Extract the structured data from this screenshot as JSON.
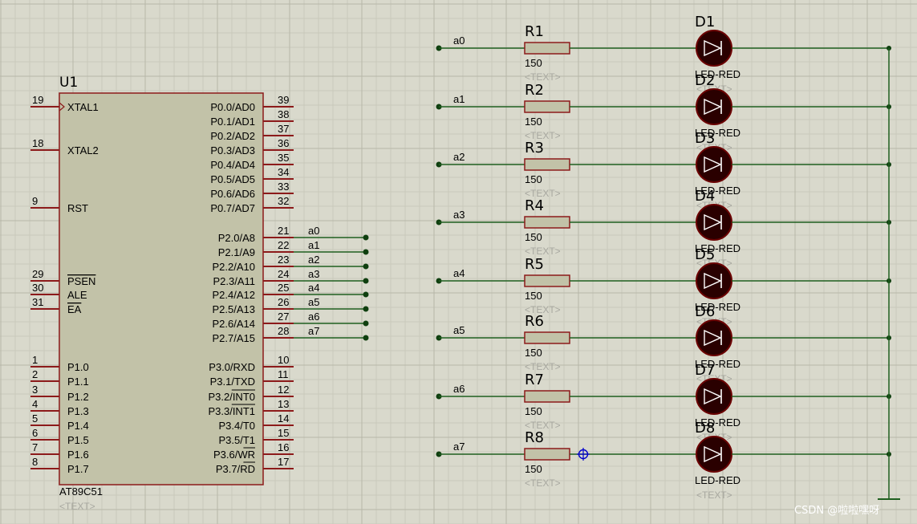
{
  "chip": {
    "ref": "U1",
    "part": "AT89C51",
    "text_placeholder": "<TEXT>",
    "left_pins": [
      {
        "num": "19",
        "label": "XTAL1",
        "clock": true
      },
      {
        "num": "18",
        "label": "XTAL2"
      },
      {
        "num": "9",
        "label": "RST"
      },
      {
        "num": "29",
        "label": "PSEN",
        "overline": true
      },
      {
        "num": "30",
        "label": "ALE"
      },
      {
        "num": "31",
        "label": "EA",
        "overline": true
      },
      {
        "num": "1",
        "label": "P1.0"
      },
      {
        "num": "2",
        "label": "P1.1"
      },
      {
        "num": "3",
        "label": "P1.2"
      },
      {
        "num": "4",
        "label": "P1.3"
      },
      {
        "num": "5",
        "label": "P1.4"
      },
      {
        "num": "6",
        "label": "P1.5"
      },
      {
        "num": "7",
        "label": "P1.6"
      },
      {
        "num": "8",
        "label": "P1.7"
      }
    ],
    "right_pins": [
      {
        "num": "39",
        "label": "P0.0/AD0"
      },
      {
        "num": "38",
        "label": "P0.1/AD1"
      },
      {
        "num": "37",
        "label": "P0.2/AD2"
      },
      {
        "num": "36",
        "label": "P0.3/AD3"
      },
      {
        "num": "35",
        "label": "P0.4/AD4"
      },
      {
        "num": "34",
        "label": "P0.5/AD5"
      },
      {
        "num": "33",
        "label": "P0.6/AD6"
      },
      {
        "num": "32",
        "label": "P0.7/AD7"
      },
      {
        "num": "21",
        "label": "P2.0/A8",
        "net": "a0"
      },
      {
        "num": "22",
        "label": "P2.1/A9",
        "net": "a1"
      },
      {
        "num": "23",
        "label": "P2.2/A10",
        "net": "a2"
      },
      {
        "num": "24",
        "label": "P2.3/A11",
        "net": "a3"
      },
      {
        "num": "25",
        "label": "P2.4/A12",
        "net": "a4"
      },
      {
        "num": "26",
        "label": "P2.5/A13",
        "net": "a5"
      },
      {
        "num": "27",
        "label": "P2.6/A14",
        "net": "a6"
      },
      {
        "num": "28",
        "label": "P2.7/A15",
        "net": "a7"
      },
      {
        "num": "10",
        "label": "P3.0/RXD"
      },
      {
        "num": "11",
        "label": "P3.1/TXD"
      },
      {
        "num": "12",
        "label": "P3.2/INT0",
        "overline_part": "INT0"
      },
      {
        "num": "13",
        "label": "P3.3/INT1",
        "overline_part": "INT1"
      },
      {
        "num": "14",
        "label": "P3.4/T0"
      },
      {
        "num": "15",
        "label": "P3.5/T1"
      },
      {
        "num": "16",
        "label": "P3.6/WR",
        "overline_part": "WR"
      },
      {
        "num": "17",
        "label": "P3.7/RD",
        "overline_part": "RD"
      }
    ]
  },
  "channels": [
    {
      "net": "a0",
      "res": "R1",
      "res_value": "150",
      "led": "D1",
      "led_part": "LED-RED"
    },
    {
      "net": "a1",
      "res": "R2",
      "res_value": "150",
      "led": "D2",
      "led_part": "LED-RED"
    },
    {
      "net": "a2",
      "res": "R3",
      "res_value": "150",
      "led": "D3",
      "led_part": "LED-RED"
    },
    {
      "net": "a3",
      "res": "R4",
      "res_value": "150",
      "led": "D4",
      "led_part": "LED-RED"
    },
    {
      "net": "a4",
      "res": "R5",
      "res_value": "150",
      "led": "D5",
      "led_part": "LED-RED"
    },
    {
      "net": "a5",
      "res": "R6",
      "res_value": "150",
      "led": "D6",
      "led_part": "LED-RED"
    },
    {
      "net": "a6",
      "res": "R7",
      "res_value": "150",
      "led": "D7",
      "led_part": "LED-RED"
    },
    {
      "net": "a7",
      "res": "R8",
      "res_value": "150",
      "led": "D8",
      "led_part": "LED-RED"
    }
  ],
  "text_placeholder": "<TEXT>",
  "watermark": "CSDN @啦啦嘿呀",
  "colors": {
    "background": "#d9d9cc",
    "grid_minor": "#c9c9bb",
    "grid_major": "#b6b6a8",
    "chip_body": "#c2c2a8",
    "chip_border": "#8c1a1a",
    "pin": "#8c1a1a",
    "wire": "#1f5f1f",
    "junction": "#0f3f0f",
    "led_body": "#2a0000",
    "led_ring": "#6a0000",
    "resistor_fill": "#c2c2a8",
    "cursor": "#0000cc"
  }
}
